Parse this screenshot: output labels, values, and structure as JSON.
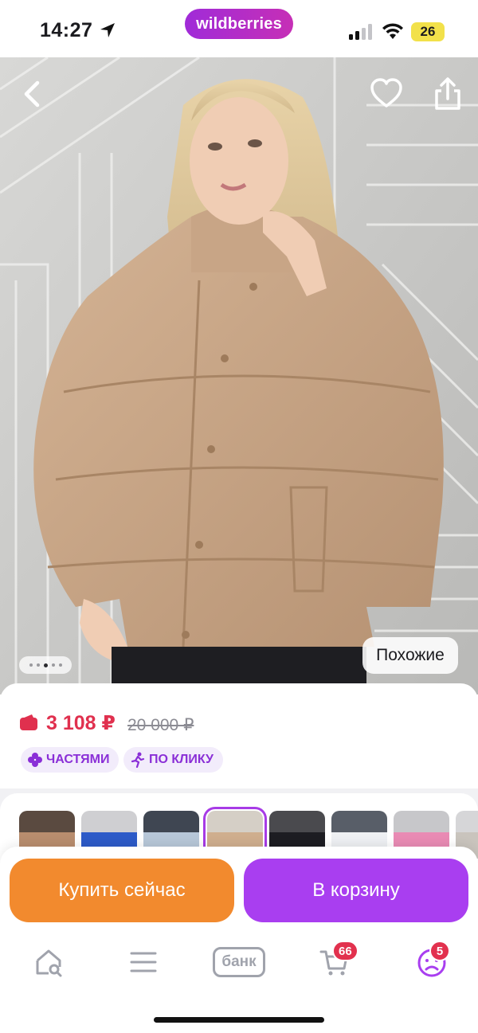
{
  "status_bar": {
    "time": "14:27",
    "battery": "26"
  },
  "brand": {
    "name": "wildberries",
    "color": "#a93ef0"
  },
  "product": {
    "price": "3 108 ₽",
    "old_price": "20 000 ₽",
    "similar_label": "Похожие",
    "gallery_total_dots": 5,
    "gallery_active_dot": 3,
    "badges": [
      {
        "label": "ЧАСТЯМИ",
        "icon": "clover-icon"
      },
      {
        "label": "ПО КЛИКУ",
        "icon": "running-man-icon"
      }
    ],
    "color_variants_selected": 4
  },
  "actions": {
    "buy_now_label": "Купить сейчас",
    "add_to_cart_label": "В корзину",
    "buy_now_color": "#f28a2e",
    "cart_color": "#a93ef0"
  },
  "nav": {
    "home_icon": "home-search-icon",
    "catalog_icon": "menu-icon",
    "bank_label": "банк",
    "cart_count": "66",
    "profile_count": "5",
    "badge_color": "#e2314e"
  }
}
